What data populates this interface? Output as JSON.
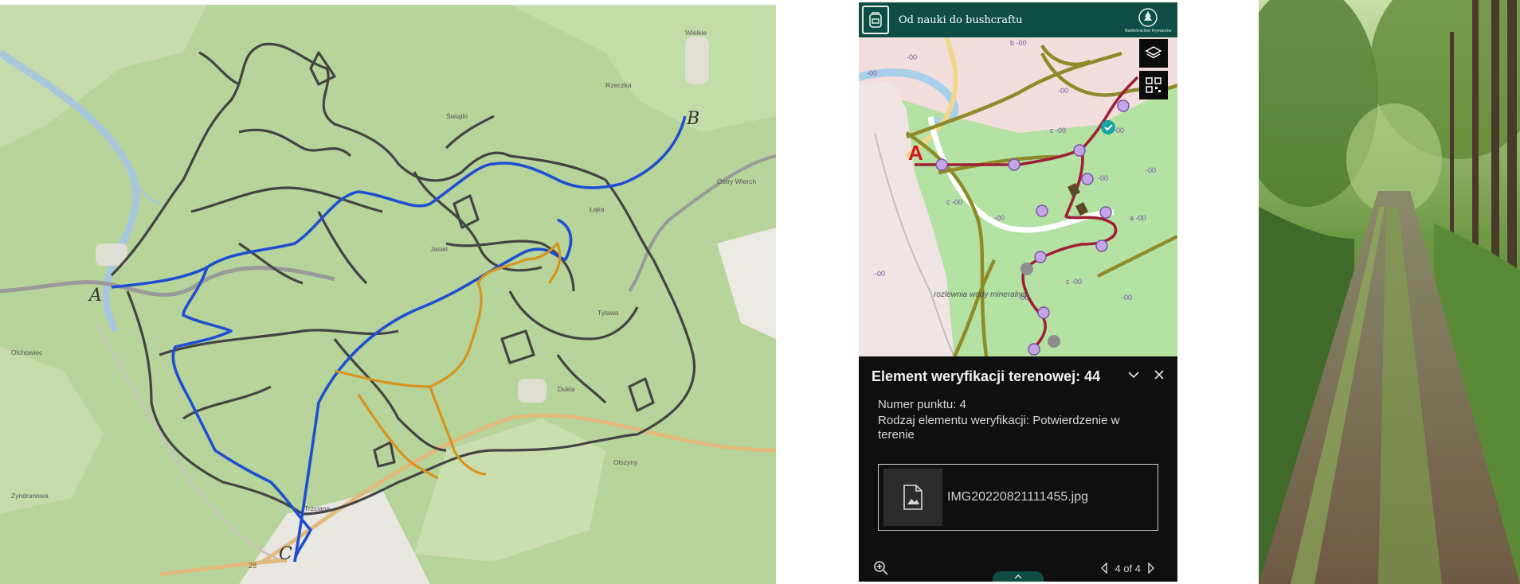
{
  "left_map": {
    "route_marker_a": "A",
    "route_marker_b": "B",
    "route_marker_c": "C",
    "place_labels": [
      "Wielkie",
      "Rzeczka",
      "Świątki",
      "Dukla",
      "Olszyny",
      "Łąka",
      "Jasiel",
      "Tylawa",
      "Olchowiec",
      "Ostry Wierch",
      "Zyndranowa",
      "Trzciana"
    ],
    "road_label": "28"
  },
  "app": {
    "title": "Od nauki do bushcraftu",
    "org_name": "Nadleśnictwo Rymanów",
    "map_marker": "A",
    "map_labels": [
      "rozlewnia wody mineralnej"
    ],
    "layers_button": "layers",
    "qr_button": "qr-code",
    "popup": {
      "title": "Element weryfikacji terenowej: 44",
      "field_number": "Numer punktu: 4",
      "field_type": "Rodzaj elementu weryfikacji: Potwierdzenie w terenie",
      "attachment_name": "IMG20220821111455.jpg",
      "pager_text": "4 of 4"
    }
  },
  "colors": {
    "header": "#0e4d45",
    "route_blue": "#1f4fd1",
    "route_orange": "#d8941e",
    "route_dark": "#3f3f3f",
    "trail_red": "#a11f36",
    "trail_olive": "#8f8a2a"
  }
}
